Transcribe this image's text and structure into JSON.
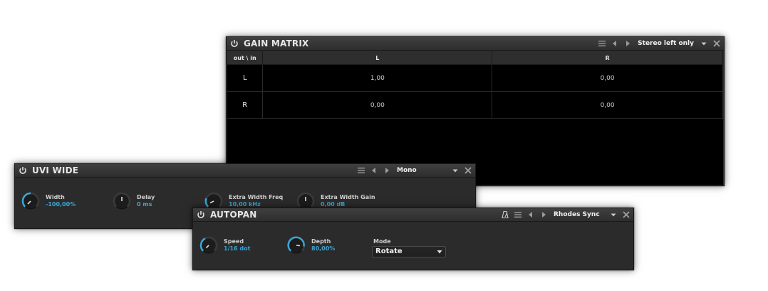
{
  "gain_matrix": {
    "title": "GAIN MATRIX",
    "preset": "Stereo left only",
    "corner_header": "out \\ in",
    "columns": [
      "L",
      "R"
    ],
    "rows": [
      {
        "label": "L",
        "values": [
          "1,00",
          "0,00"
        ]
      },
      {
        "label": "R",
        "values": [
          "0,00",
          "0,00"
        ]
      }
    ]
  },
  "uvi_wide": {
    "title": "UVI WIDE",
    "preset": "Mono",
    "knobs": [
      {
        "name": "Width",
        "value": "-100,00%"
      },
      {
        "name": "Delay",
        "value": "0 ms"
      },
      {
        "name": "Extra Width Freq",
        "value": "10,00 kHz"
      },
      {
        "name": "Extra Width Gain",
        "value": "0,00 dB"
      }
    ]
  },
  "autopan": {
    "title": "AUTOPAN",
    "preset": "Rhodes Sync",
    "knobs": [
      {
        "name": "Speed",
        "value": "1/16 dot"
      },
      {
        "name": "Depth",
        "value": "80,00%"
      }
    ],
    "mode_label": "Mode",
    "mode_value": "Rotate"
  },
  "icons": {
    "power": "power-icon",
    "menu": "hamburger-menu-icon",
    "prev": "previous-preset-icon",
    "next": "next-preset-icon",
    "dropdown": "dropdown-caret-icon",
    "close": "close-icon",
    "sync": "metronome-sync-icon"
  },
  "colors": {
    "accent": "#3aa6d6",
    "power": "#d8d8d8",
    "panel_bg": "#2b2b2b",
    "matrix_bg": "#000000"
  }
}
